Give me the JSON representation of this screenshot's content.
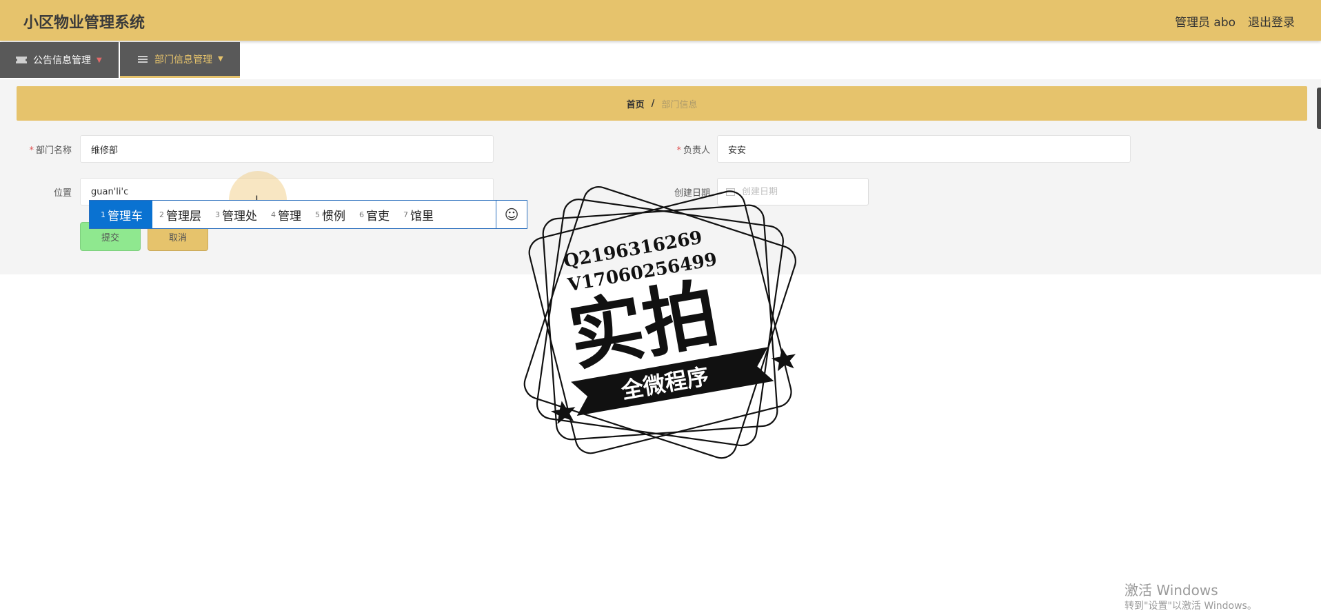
{
  "header": {
    "app_title": "小区物业管理系统",
    "admin_label": "管理员 abo",
    "logout_label": "退出登录"
  },
  "nav": {
    "items": [
      {
        "label": "公告信息管理",
        "active": false
      },
      {
        "label": "部门信息管理",
        "active": true
      }
    ]
  },
  "breadcrumb": {
    "home": "首页",
    "separator": "/",
    "current": "部门信息"
  },
  "form": {
    "dept_name_label": "部门名称",
    "dept_name_value": "维修部",
    "manager_label": "负责人",
    "manager_value": "安安",
    "location_label": "位置",
    "location_value": "guan'li'c",
    "created_date_label": "创建日期",
    "created_date_placeholder": "创建日期",
    "required_mark": "*",
    "submit_label": "提交",
    "cancel_label": "取消"
  },
  "ime": {
    "candidates": [
      {
        "num": "1",
        "text": "管理车"
      },
      {
        "num": "2",
        "text": "管理层"
      },
      {
        "num": "3",
        "text": "管理处"
      },
      {
        "num": "4",
        "text": "管理"
      },
      {
        "num": "5",
        "text": "惯例"
      },
      {
        "num": "6",
        "text": "官吏"
      },
      {
        "num": "7",
        "text": "馆里"
      }
    ],
    "emoji_symbol": "☺"
  },
  "watermark": {
    "line1": "Q2196316269",
    "line2": "V17060256499",
    "big_text": "实拍",
    "banner_text": "全微程序"
  },
  "windows_activation": {
    "title": "激活 Windows",
    "subtitle": "转到\"设置\"以激活 Windows。"
  },
  "colors": {
    "brand": "#e6c36c",
    "nav_bg": "#595959",
    "submit_green": "#8fe88f",
    "required_red": "#e05555",
    "ime_blue": "#0a72d1"
  }
}
